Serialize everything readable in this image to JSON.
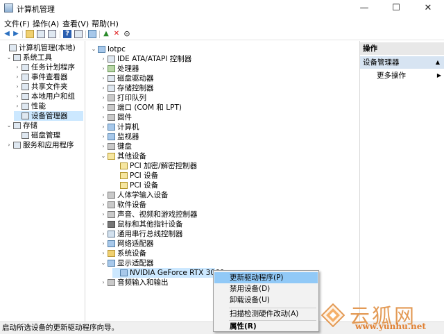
{
  "window": {
    "title": "计算机管理",
    "minimize": "—",
    "maximize": "☐",
    "close": "✕"
  },
  "menubar": [
    "文件(F)",
    "操作(A)",
    "查看(V)",
    "帮助(H)"
  ],
  "left_tree": [
    {
      "label": "计算机管理(本地)",
      "expander": "",
      "icon": "computer-management-icon"
    },
    {
      "label": "系统工具",
      "expander": "⌄",
      "icon": "system-tools-icon"
    },
    {
      "label": "任务计划程序",
      "expander": "›",
      "icon": "task-scheduler-icon"
    },
    {
      "label": "事件查看器",
      "expander": "›",
      "icon": "event-viewer-icon"
    },
    {
      "label": "共享文件夹",
      "expander": "›",
      "icon": "shared-folders-icon"
    },
    {
      "label": "本地用户和组",
      "expander": "›",
      "icon": "users-icon"
    },
    {
      "label": "性能",
      "expander": "›",
      "icon": "performance-icon"
    },
    {
      "label": "设备管理器",
      "expander": "",
      "icon": "device-manager-icon"
    },
    {
      "label": "存储",
      "expander": "⌄",
      "icon": "storage-icon"
    },
    {
      "label": "磁盘管理",
      "expander": "",
      "icon": "disk-management-icon"
    },
    {
      "label": "服务和应用程序",
      "expander": "›",
      "icon": "services-icon"
    }
  ],
  "device_tree": [
    {
      "label": "lotpc",
      "expander": "⌄",
      "icon": "computer-icon"
    },
    {
      "label": "IDE ATA/ATAPI 控制器",
      "expander": "›",
      "icon": "ide-controller-icon"
    },
    {
      "label": "处理器",
      "expander": "›",
      "icon": "processor-icon"
    },
    {
      "label": "磁盘驱动器",
      "expander": "›",
      "icon": "disk-drive-icon"
    },
    {
      "label": "存储控制器",
      "expander": "›",
      "icon": "storage-controller-icon"
    },
    {
      "label": "打印队列",
      "expander": "›",
      "icon": "print-queue-icon"
    },
    {
      "label": "端口 (COM 和 LPT)",
      "expander": "›",
      "icon": "port-icon"
    },
    {
      "label": "固件",
      "expander": "›",
      "icon": "firmware-icon"
    },
    {
      "label": "计算机",
      "expander": "›",
      "icon": "computer-icon"
    },
    {
      "label": "监视器",
      "expander": "›",
      "icon": "monitor-icon"
    },
    {
      "label": "键盘",
      "expander": "›",
      "icon": "keyboard-icon"
    },
    {
      "label": "其他设备",
      "expander": "⌄",
      "icon": "other-devices-icon"
    },
    {
      "label": "PCI 加密/解密控制器",
      "expander": "",
      "icon": "warning-device-icon"
    },
    {
      "label": "PCI 设备",
      "expander": "",
      "icon": "warning-device-icon"
    },
    {
      "label": "PCI 设备",
      "expander": "",
      "icon": "warning-device-icon"
    },
    {
      "label": "人体学输入设备",
      "expander": "›",
      "icon": "hid-icon"
    },
    {
      "label": "软件设备",
      "expander": "›",
      "icon": "software-device-icon"
    },
    {
      "label": "声音、视频和游戏控制器",
      "expander": "›",
      "icon": "sound-icon"
    },
    {
      "label": "鼠标和其他指针设备",
      "expander": "›",
      "icon": "mouse-icon"
    },
    {
      "label": "通用串行总线控制器",
      "expander": "›",
      "icon": "usb-icon"
    },
    {
      "label": "网络适配器",
      "expander": "›",
      "icon": "network-adapter-icon"
    },
    {
      "label": "系统设备",
      "expander": "›",
      "icon": "system-device-icon"
    },
    {
      "label": "显示适配器",
      "expander": "⌄",
      "icon": "display-adapter-icon"
    },
    {
      "label": "NVIDIA GeForce RTX 3060",
      "expander": "",
      "icon": "gpu-icon"
    },
    {
      "label": "音频输入和输出",
      "expander": "›",
      "icon": "audio-icon"
    }
  ],
  "actions": {
    "header": "操作",
    "selected": "设备管理器",
    "more": "更多操作"
  },
  "context_menu": [
    "更新驱动程序(P)",
    "禁用设备(D)",
    "卸载设备(U)",
    "扫描检测硬件改动(A)",
    "属性(R)"
  ],
  "status_text": "启动所选设备的更新驱动程序向导。",
  "watermark": {
    "brand": "云狐网",
    "url": "www.yunhu.net"
  },
  "colors": {
    "selection": "#cce8ff",
    "menu_highlight": "#91c9f7",
    "action_selected": "#d7e4f2",
    "watermark": "#e39a55"
  }
}
